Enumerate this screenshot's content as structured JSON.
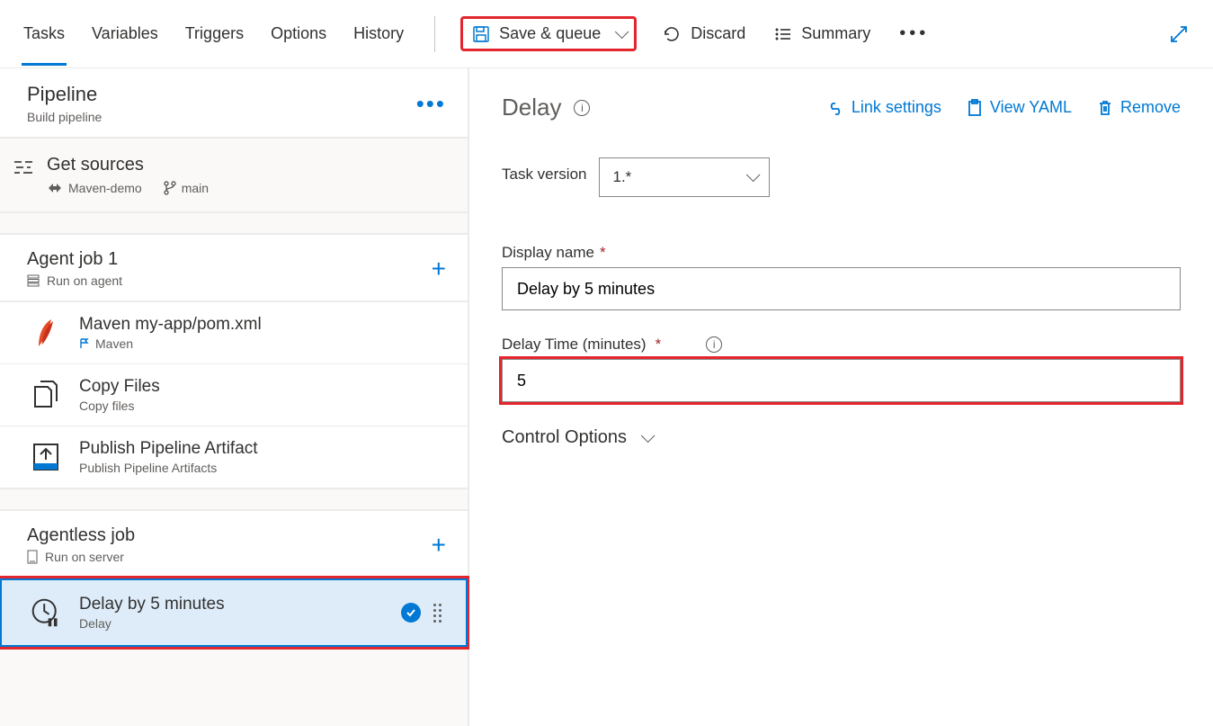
{
  "tabs": {
    "tasks": "Tasks",
    "variables": "Variables",
    "triggers": "Triggers",
    "options": "Options",
    "history": "History"
  },
  "toolbar": {
    "save_queue": "Save & queue",
    "discard": "Discard",
    "summary": "Summary"
  },
  "left": {
    "pipeline_title": "Pipeline",
    "pipeline_sub": "Build pipeline",
    "get_sources": "Get sources",
    "repo": "Maven-demo",
    "branch": "main",
    "job1_title": "Agent job 1",
    "job1_sub": "Run on agent",
    "tasks": [
      {
        "title": "Maven my-app/pom.xml",
        "sub": "Maven"
      },
      {
        "title": "Copy Files",
        "sub": "Copy files"
      },
      {
        "title": "Publish Pipeline Artifact",
        "sub": "Publish Pipeline Artifacts"
      }
    ],
    "job2_title": "Agentless job",
    "job2_sub": "Run on server",
    "selected_task": {
      "title": "Delay by 5 minutes",
      "sub": "Delay"
    }
  },
  "right": {
    "header": "Delay",
    "link_settings": "Link settings",
    "view_yaml": "View YAML",
    "remove": "Remove",
    "task_version_label": "Task version",
    "task_version_value": "1.*",
    "display_name_label": "Display name",
    "display_name_value": "Delay by 5 minutes",
    "delay_time_label": "Delay Time (minutes)",
    "delay_time_value": "5",
    "control_options": "Control Options"
  }
}
